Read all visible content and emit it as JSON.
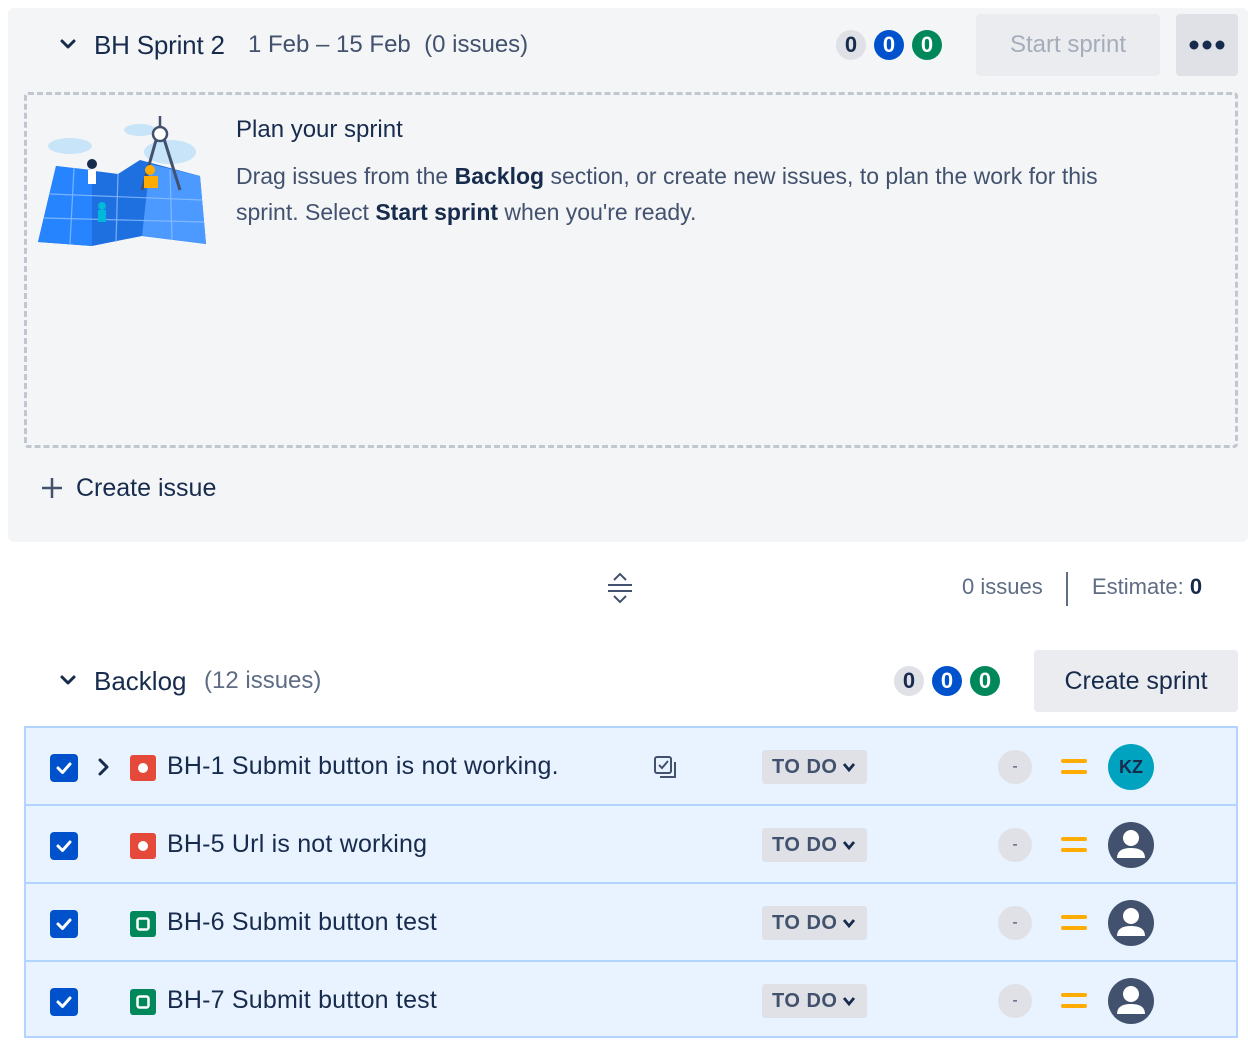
{
  "sprint": {
    "name": "BH Sprint 2",
    "dates": "1 Feb – 15 Feb",
    "issue_count": "(0 issues)",
    "counts": {
      "todo": "0",
      "in_progress": "0",
      "done": "0"
    },
    "start_label": "Start sprint",
    "empty_title": "Plan your sprint",
    "empty_desc_1": "Drag issues from the ",
    "empty_desc_backlog": "Backlog",
    "empty_desc_2": " section, or create new issues, to plan the work for this sprint. Select ",
    "empty_desc_start": "Start sprint",
    "empty_desc_3": " when you're ready.",
    "create_issue_label": "Create issue"
  },
  "summary": {
    "issues": "0 issues",
    "estimate_label": "Estimate:",
    "estimate_value": "0"
  },
  "backlog": {
    "name": "Backlog",
    "issue_count": "(12 issues)",
    "counts": {
      "todo": "0",
      "in_progress": "0",
      "done": "0"
    },
    "create_sprint_label": "Create sprint",
    "issues": [
      {
        "key": "BH-1",
        "summary": "Submit button is not working.",
        "type": "bug",
        "has_children": true,
        "status": "TO DO",
        "estimate": "-",
        "priority": "medium",
        "assignee": "KZ"
      },
      {
        "key": "BH-5",
        "summary": "Url is not working",
        "type": "bug",
        "has_children": false,
        "status": "TO DO",
        "estimate": "-",
        "priority": "medium",
        "assignee": ""
      },
      {
        "key": "BH-6",
        "summary": "Submit button test",
        "type": "task",
        "has_children": false,
        "status": "TO DO",
        "estimate": "-",
        "priority": "medium",
        "assignee": ""
      },
      {
        "key": "BH-7",
        "summary": "Submit button test",
        "type": "task",
        "has_children": false,
        "status": "TO DO",
        "estimate": "-",
        "priority": "medium",
        "assignee": ""
      }
    ]
  },
  "icons": {
    "collapse": "chevron-down-icon",
    "more": "more-horizontal-icon",
    "add": "plus-icon",
    "resize": "drag-handle-icon",
    "expand": "chevron-right-icon",
    "bug": "bug-icon",
    "task": "task-icon",
    "child_issues": "child-issues-icon",
    "priority": "priority-medium-icon",
    "avatar": "user-avatar-icon"
  },
  "colors": {
    "accent_blue": "#0052cc",
    "done_green": "#00875a",
    "bug_red": "#e5493a",
    "priority_medium": "#ffab00",
    "row_selected_bg": "#e9f2ff"
  }
}
